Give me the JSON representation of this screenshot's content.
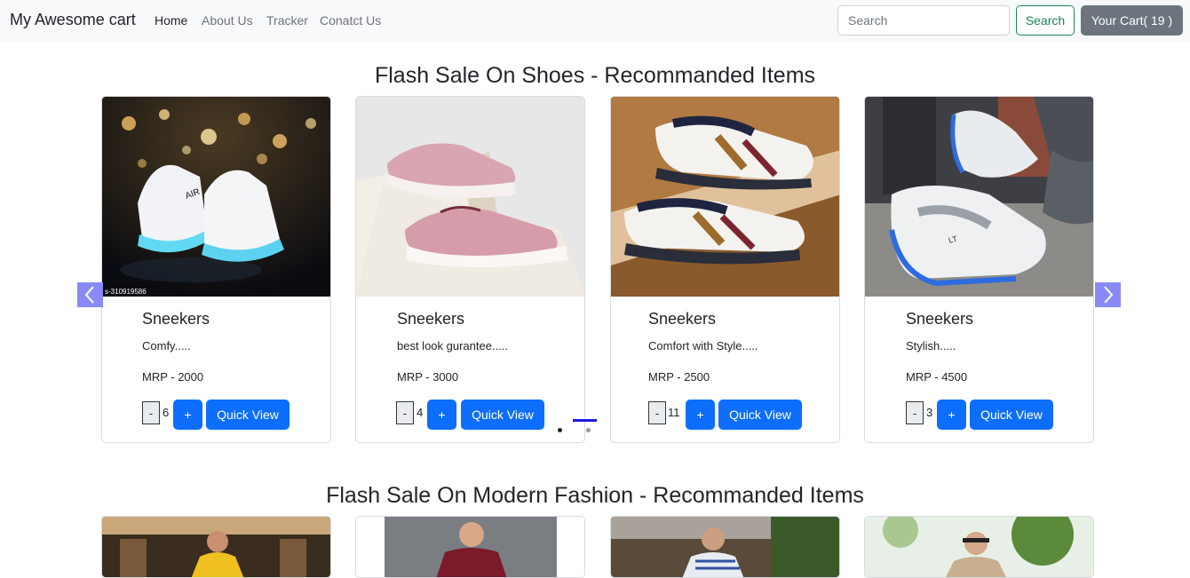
{
  "navbar": {
    "brand": "My Awesome cart",
    "links": [
      {
        "label": "Home",
        "active": true
      },
      {
        "label": "About Us",
        "active": false
      },
      {
        "label": "Tracker",
        "active": false
      },
      {
        "label": "Conatct Us",
        "active": false
      }
    ],
    "search_placeholder": "Search",
    "search_button": "Search",
    "cart_button": "Your Cart( 19 )"
  },
  "sections": [
    {
      "title": "Flash Sale On Shoes - Recommanded Items",
      "products": [
        {
          "name": "Sneekers",
          "description": "Comfy.....",
          "price": "MRP - 2000",
          "qty": "6",
          "minus": "-",
          "plus": "+",
          "quick_view": "Quick View",
          "image_caption": "s-310919586"
        },
        {
          "name": "Sneekers",
          "description": "best look gurantee.....",
          "price": "MRP - 3000",
          "qty": "4",
          "minus": "-",
          "plus": "+",
          "quick_view": "Quick View"
        },
        {
          "name": "Sneekers",
          "description": "Comfort with Style.....",
          "price": "MRP - 2500",
          "qty": "11",
          "minus": "-",
          "plus": "+",
          "quick_view": "Quick View"
        },
        {
          "name": "Sneekers",
          "description": "Stylish.....",
          "price": "MRP - 4500",
          "qty": "3",
          "minus": "-",
          "plus": "+",
          "quick_view": "Quick View"
        }
      ]
    },
    {
      "title": "Flash Sale On Modern Fashion - Recommanded Items"
    }
  ],
  "colors": {
    "primary": "#0d6efd",
    "success": "#198754",
    "secondary": "#6c757d",
    "carousel_control": "#8a8af7"
  },
  "icons": {
    "prev": "chevron-left-icon",
    "next": "chevron-right-icon"
  }
}
